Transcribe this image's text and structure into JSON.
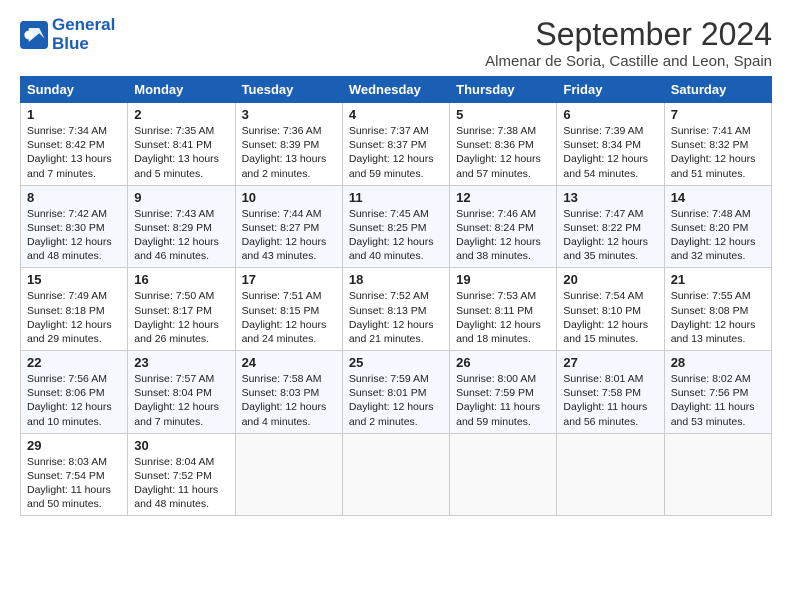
{
  "header": {
    "logo_line1": "General",
    "logo_line2": "Blue",
    "month": "September 2024",
    "location": "Almenar de Soria, Castille and Leon, Spain"
  },
  "weekdays": [
    "Sunday",
    "Monday",
    "Tuesday",
    "Wednesday",
    "Thursday",
    "Friday",
    "Saturday"
  ],
  "weeks": [
    [
      {
        "day": "1",
        "lines": [
          "Sunrise: 7:34 AM",
          "Sunset: 8:42 PM",
          "Daylight: 13 hours",
          "and 7 minutes."
        ]
      },
      {
        "day": "2",
        "lines": [
          "Sunrise: 7:35 AM",
          "Sunset: 8:41 PM",
          "Daylight: 13 hours",
          "and 5 minutes."
        ]
      },
      {
        "day": "3",
        "lines": [
          "Sunrise: 7:36 AM",
          "Sunset: 8:39 PM",
          "Daylight: 13 hours",
          "and 2 minutes."
        ]
      },
      {
        "day": "4",
        "lines": [
          "Sunrise: 7:37 AM",
          "Sunset: 8:37 PM",
          "Daylight: 12 hours",
          "and 59 minutes."
        ]
      },
      {
        "day": "5",
        "lines": [
          "Sunrise: 7:38 AM",
          "Sunset: 8:36 PM",
          "Daylight: 12 hours",
          "and 57 minutes."
        ]
      },
      {
        "day": "6",
        "lines": [
          "Sunrise: 7:39 AM",
          "Sunset: 8:34 PM",
          "Daylight: 12 hours",
          "and 54 minutes."
        ]
      },
      {
        "day": "7",
        "lines": [
          "Sunrise: 7:41 AM",
          "Sunset: 8:32 PM",
          "Daylight: 12 hours",
          "and 51 minutes."
        ]
      }
    ],
    [
      {
        "day": "8",
        "lines": [
          "Sunrise: 7:42 AM",
          "Sunset: 8:30 PM",
          "Daylight: 12 hours",
          "and 48 minutes."
        ]
      },
      {
        "day": "9",
        "lines": [
          "Sunrise: 7:43 AM",
          "Sunset: 8:29 PM",
          "Daylight: 12 hours",
          "and 46 minutes."
        ]
      },
      {
        "day": "10",
        "lines": [
          "Sunrise: 7:44 AM",
          "Sunset: 8:27 PM",
          "Daylight: 12 hours",
          "and 43 minutes."
        ]
      },
      {
        "day": "11",
        "lines": [
          "Sunrise: 7:45 AM",
          "Sunset: 8:25 PM",
          "Daylight: 12 hours",
          "and 40 minutes."
        ]
      },
      {
        "day": "12",
        "lines": [
          "Sunrise: 7:46 AM",
          "Sunset: 8:24 PM",
          "Daylight: 12 hours",
          "and 38 minutes."
        ]
      },
      {
        "day": "13",
        "lines": [
          "Sunrise: 7:47 AM",
          "Sunset: 8:22 PM",
          "Daylight: 12 hours",
          "and 35 minutes."
        ]
      },
      {
        "day": "14",
        "lines": [
          "Sunrise: 7:48 AM",
          "Sunset: 8:20 PM",
          "Daylight: 12 hours",
          "and 32 minutes."
        ]
      }
    ],
    [
      {
        "day": "15",
        "lines": [
          "Sunrise: 7:49 AM",
          "Sunset: 8:18 PM",
          "Daylight: 12 hours",
          "and 29 minutes."
        ]
      },
      {
        "day": "16",
        "lines": [
          "Sunrise: 7:50 AM",
          "Sunset: 8:17 PM",
          "Daylight: 12 hours",
          "and 26 minutes."
        ]
      },
      {
        "day": "17",
        "lines": [
          "Sunrise: 7:51 AM",
          "Sunset: 8:15 PM",
          "Daylight: 12 hours",
          "and 24 minutes."
        ]
      },
      {
        "day": "18",
        "lines": [
          "Sunrise: 7:52 AM",
          "Sunset: 8:13 PM",
          "Daylight: 12 hours",
          "and 21 minutes."
        ]
      },
      {
        "day": "19",
        "lines": [
          "Sunrise: 7:53 AM",
          "Sunset: 8:11 PM",
          "Daylight: 12 hours",
          "and 18 minutes."
        ]
      },
      {
        "day": "20",
        "lines": [
          "Sunrise: 7:54 AM",
          "Sunset: 8:10 PM",
          "Daylight: 12 hours",
          "and 15 minutes."
        ]
      },
      {
        "day": "21",
        "lines": [
          "Sunrise: 7:55 AM",
          "Sunset: 8:08 PM",
          "Daylight: 12 hours",
          "and 13 minutes."
        ]
      }
    ],
    [
      {
        "day": "22",
        "lines": [
          "Sunrise: 7:56 AM",
          "Sunset: 8:06 PM",
          "Daylight: 12 hours",
          "and 10 minutes."
        ]
      },
      {
        "day": "23",
        "lines": [
          "Sunrise: 7:57 AM",
          "Sunset: 8:04 PM",
          "Daylight: 12 hours",
          "and 7 minutes."
        ]
      },
      {
        "day": "24",
        "lines": [
          "Sunrise: 7:58 AM",
          "Sunset: 8:03 PM",
          "Daylight: 12 hours",
          "and 4 minutes."
        ]
      },
      {
        "day": "25",
        "lines": [
          "Sunrise: 7:59 AM",
          "Sunset: 8:01 PM",
          "Daylight: 12 hours",
          "and 2 minutes."
        ]
      },
      {
        "day": "26",
        "lines": [
          "Sunrise: 8:00 AM",
          "Sunset: 7:59 PM",
          "Daylight: 11 hours",
          "and 59 minutes."
        ]
      },
      {
        "day": "27",
        "lines": [
          "Sunrise: 8:01 AM",
          "Sunset: 7:58 PM",
          "Daylight: 11 hours",
          "and 56 minutes."
        ]
      },
      {
        "day": "28",
        "lines": [
          "Sunrise: 8:02 AM",
          "Sunset: 7:56 PM",
          "Daylight: 11 hours",
          "and 53 minutes."
        ]
      }
    ],
    [
      {
        "day": "29",
        "lines": [
          "Sunrise: 8:03 AM",
          "Sunset: 7:54 PM",
          "Daylight: 11 hours",
          "and 50 minutes."
        ]
      },
      {
        "day": "30",
        "lines": [
          "Sunrise: 8:04 AM",
          "Sunset: 7:52 PM",
          "Daylight: 11 hours",
          "and 48 minutes."
        ]
      },
      {
        "day": "",
        "lines": []
      },
      {
        "day": "",
        "lines": []
      },
      {
        "day": "",
        "lines": []
      },
      {
        "day": "",
        "lines": []
      },
      {
        "day": "",
        "lines": []
      }
    ]
  ]
}
